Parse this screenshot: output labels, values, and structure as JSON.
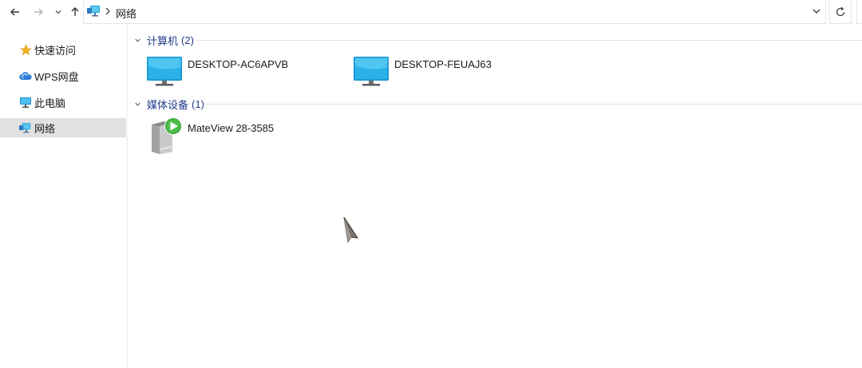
{
  "address_bar": {
    "location": "网络"
  },
  "sidebar": {
    "items": [
      {
        "label": "快速访问",
        "icon": "star-icon",
        "selected": false
      },
      {
        "label": "WPS网盘",
        "icon": "cloud-icon",
        "selected": false
      },
      {
        "label": "此电脑",
        "icon": "computer-icon",
        "selected": false
      },
      {
        "label": "网络",
        "icon": "network-icon",
        "selected": true
      }
    ]
  },
  "content": {
    "groups": [
      {
        "title": "计算机",
        "count": "(2)",
        "items": [
          {
            "label": "DESKTOP-AC6APVB",
            "icon": "monitor-icon"
          },
          {
            "label": "DESKTOP-FEUAJ63",
            "icon": "monitor-icon"
          }
        ]
      },
      {
        "title": "媒体设备",
        "count": "(1)",
        "items": [
          {
            "label": "MateView 28-3585",
            "icon": "media-device-icon"
          }
        ]
      }
    ]
  },
  "colors": {
    "group_header": "#1f3c8a",
    "selected_bg": "#e1e1e1",
    "monitor_screen": "#1aa3d9",
    "play_green": "#3aa43a"
  }
}
